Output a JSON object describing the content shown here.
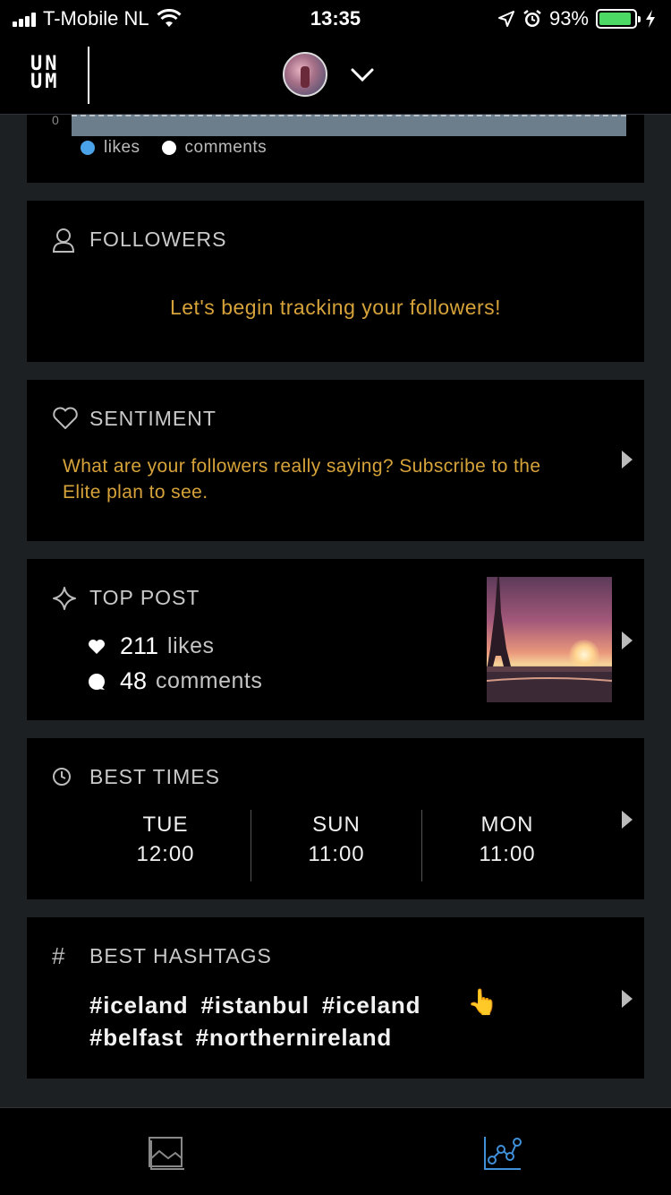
{
  "status_bar": {
    "carrier": "T-Mobile NL",
    "time": "13:35",
    "battery": "93%",
    "battery_level": 0.93
  },
  "header": {
    "logo_top": "UN",
    "logo_bottom": "UM"
  },
  "engagement_chart": {
    "axis_zero": "0",
    "legend": [
      {
        "label": "likes",
        "color": "#4aa3e8"
      },
      {
        "label": "comments",
        "color": "#ffffff"
      }
    ]
  },
  "followers": {
    "title": "FOLLOWERS",
    "message": "Let's begin tracking your followers!"
  },
  "sentiment": {
    "title": "SENTIMENT",
    "message": "What are your followers really saying? Subscribe to the Elite plan to see."
  },
  "top_post": {
    "title": "TOP POST",
    "likes_count": "211",
    "likes_label": "likes",
    "comments_count": "48",
    "comments_label": "comments"
  },
  "best_times": {
    "title": "BEST TIMES",
    "slots": [
      {
        "day": "TUE",
        "time": "12:00"
      },
      {
        "day": "SUN",
        "time": "11:00"
      },
      {
        "day": "MON",
        "time": "11:00"
      }
    ]
  },
  "best_hashtags": {
    "title": "BEST HASHTAGS",
    "tags": [
      "#iceland",
      "#istanbul",
      "#iceland",
      "#belfast",
      "#northernireland"
    ],
    "emoji": "👆"
  },
  "colors": {
    "accent_gold": "#d6a33a",
    "active_tab": "#3f8fd9",
    "background": "#1c2023"
  },
  "tab_bar": {
    "items": [
      {
        "name": "gallery-icon",
        "active": false
      },
      {
        "name": "analytics-icon",
        "active": true
      }
    ]
  }
}
